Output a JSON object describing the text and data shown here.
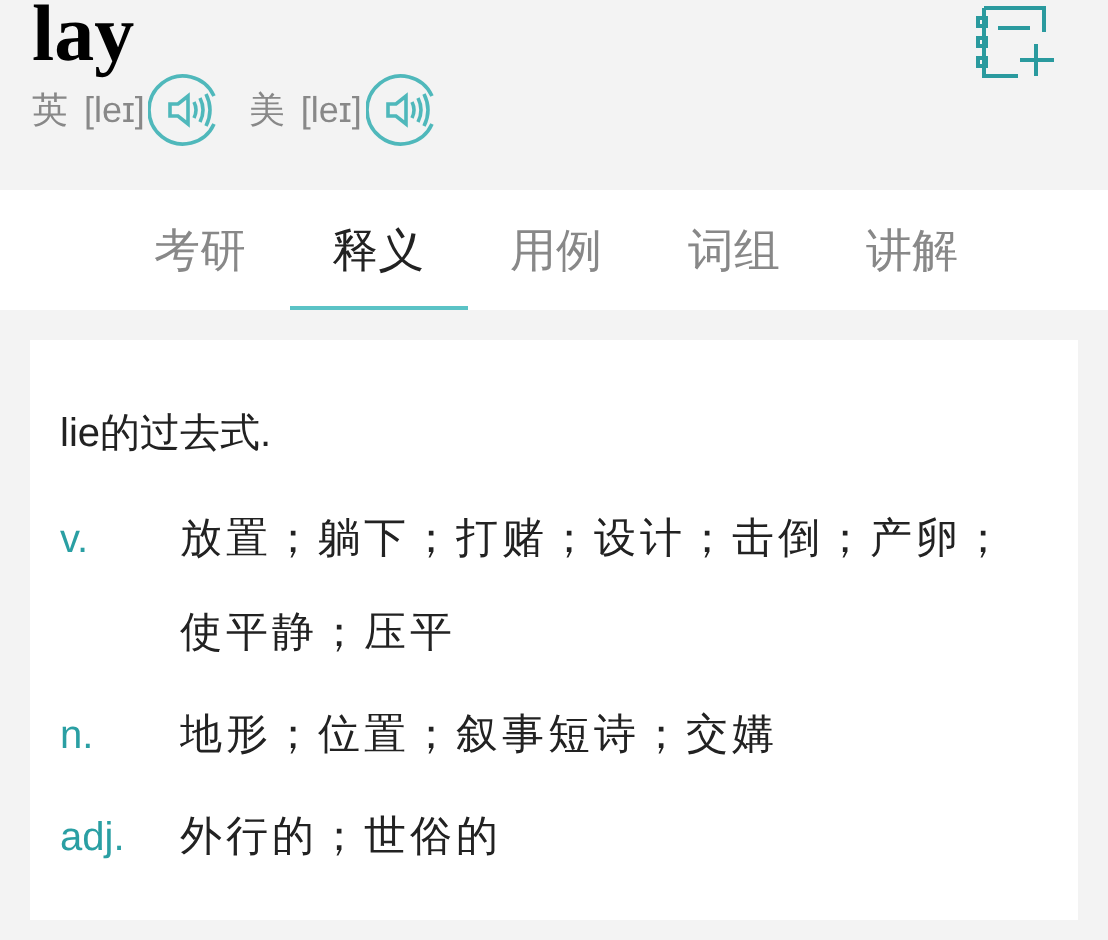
{
  "word": "lay",
  "pronunciations": [
    {
      "region": "英",
      "phonetic": "[leɪ]"
    },
    {
      "region": "美",
      "phonetic": "[leɪ]"
    }
  ],
  "tabs": [
    {
      "label": "考研",
      "selected": false
    },
    {
      "label": "释义",
      "selected": true
    },
    {
      "label": "用例",
      "selected": false
    },
    {
      "label": "词组",
      "selected": false
    },
    {
      "label": "讲解",
      "selected": false
    }
  ],
  "definition_note": "lie的过去式.",
  "definitions": [
    {
      "pos": "v.",
      "meaning": "放置；躺下；打赌；设计；击倒；产卵；使平静；压平"
    },
    {
      "pos": "n.",
      "meaning": "地形；位置；叙事短诗；交媾"
    },
    {
      "pos": "adj.",
      "meaning": "外行的；世俗的"
    }
  ]
}
